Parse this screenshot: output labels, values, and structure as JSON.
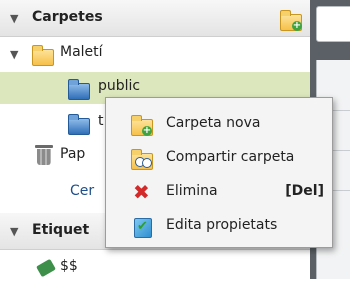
{
  "sidebar": {
    "folders_section": {
      "title": "Carpetes"
    },
    "tree": {
      "root": {
        "label": "Maletí"
      },
      "public": {
        "label": "public"
      },
      "second_folder": {
        "label": "t"
      },
      "trash": {
        "label": "Pap"
      },
      "search": {
        "label": "Cer"
      }
    },
    "tags_section": {
      "title": "Etiquet"
    },
    "tags": [
      {
        "label": "$$"
      }
    ]
  },
  "context_menu": {
    "items": [
      {
        "label": "Carpeta nova",
        "icon": "new-folder-icon"
      },
      {
        "label": "Compartir carpeta",
        "icon": "share-folder-icon"
      },
      {
        "label": "Elimina",
        "shortcut": "[Del]",
        "icon": "delete-icon"
      },
      {
        "label": "Edita propietats",
        "icon": "edit-properties-icon"
      }
    ]
  },
  "colors": {
    "selection": "#dde7bd",
    "link_blue": "#1f4f8a",
    "delete_red": "#d22a2a",
    "folder_yellow": "#f6c04a",
    "folder_blue": "#2f6fb8"
  }
}
